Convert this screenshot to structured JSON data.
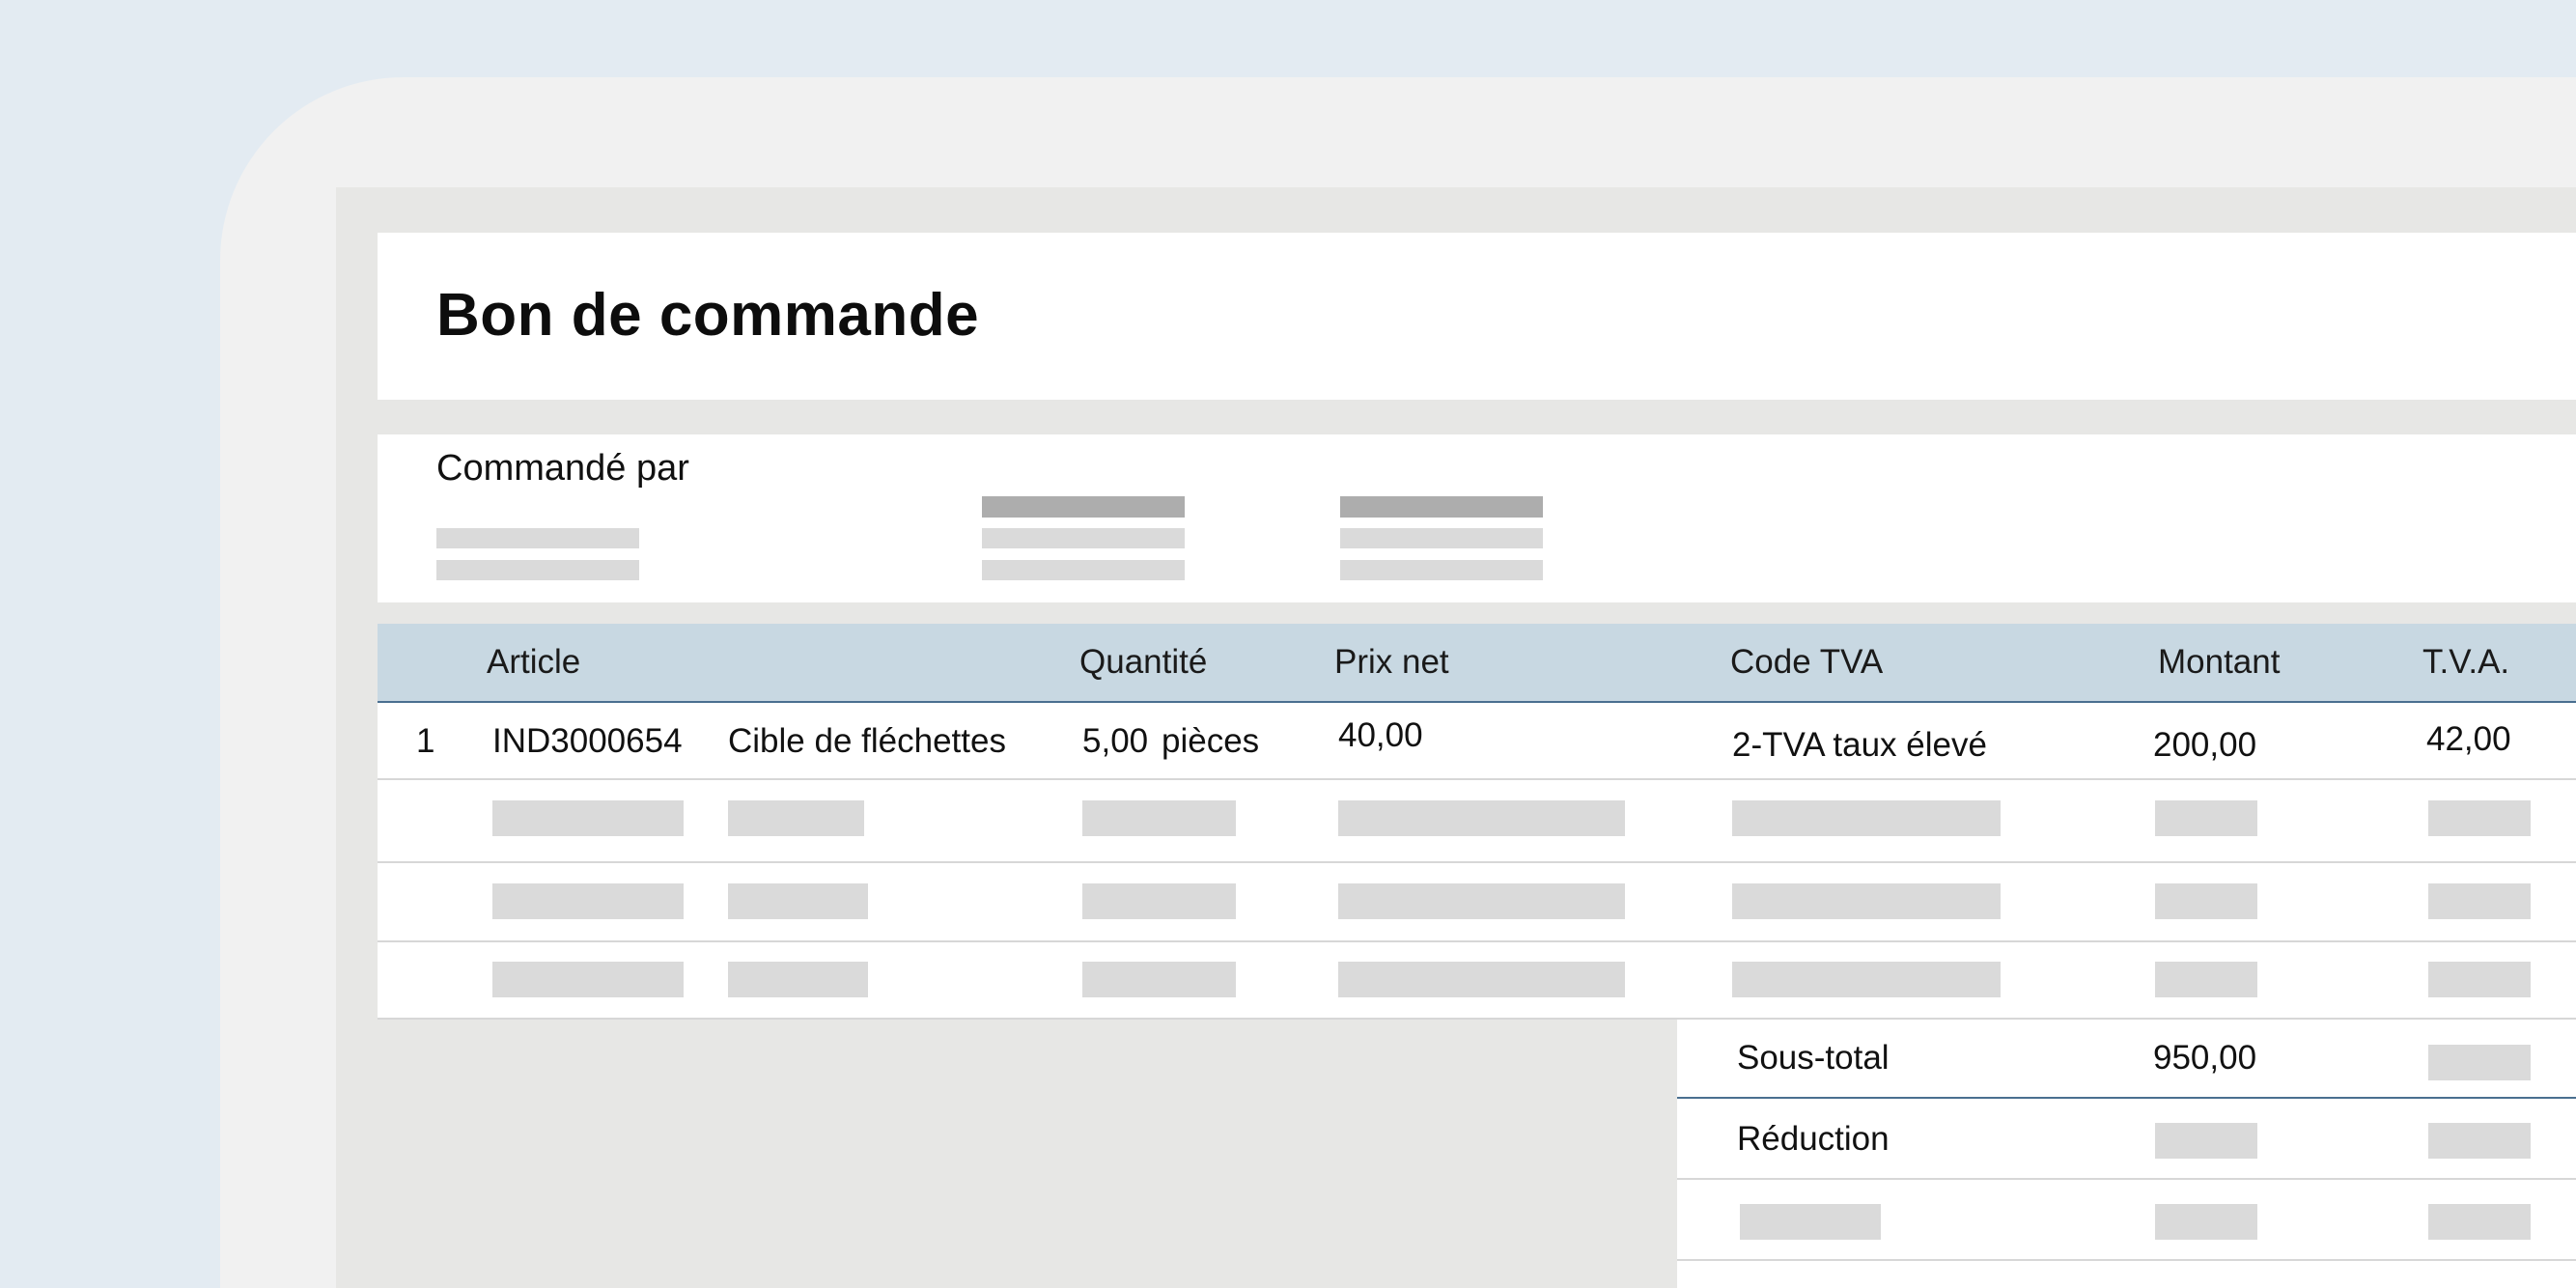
{
  "document": {
    "title": "Bon de commande",
    "ordered_by_label": "Commandé par"
  },
  "table": {
    "headers": [
      "Article",
      "Quantité",
      "Prix net",
      "Code TVA",
      "Montant",
      "T.V.A."
    ],
    "rows": [
      {
        "number": "1",
        "article_code": "IND3000654",
        "description": "Cible de fléchettes",
        "quantity": "5,00",
        "unit": "pièces",
        "net_price": "40,00",
        "vat_code": "2-TVA taux élevé",
        "amount": "200,00",
        "vat": "42,00"
      }
    ]
  },
  "totals": {
    "subtotal_label": "Sous-total",
    "subtotal_value": "950,00",
    "discount_label": "Réduction"
  },
  "colors": {
    "background": "#e3ebf2",
    "header_band": "#c8d8e2",
    "header_rule": "#4a6f90",
    "placeholder": "#dadada"
  }
}
